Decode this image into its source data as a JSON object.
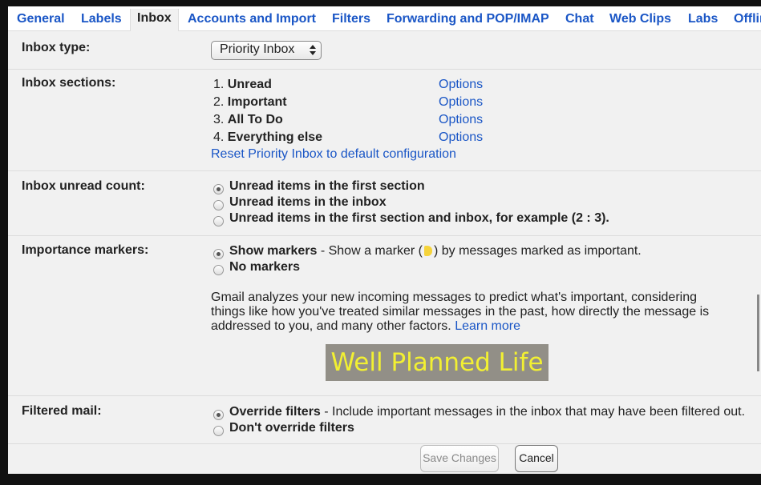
{
  "tabs": [
    "General",
    "Labels",
    "Inbox",
    "Accounts and Import",
    "Filters",
    "Forwarding and POP/IMAP",
    "Chat",
    "Web Clips",
    "Labs",
    "Offline"
  ],
  "inbox_type": {
    "label": "Inbox type:",
    "selected": "Priority Inbox"
  },
  "inbox_sections": {
    "label": "Inbox sections:",
    "items": [
      {
        "num": "1.",
        "name": "Unread",
        "options": "Options"
      },
      {
        "num": "2.",
        "name": "Important",
        "options": "Options"
      },
      {
        "num": "3.",
        "name": "All To Do",
        "options": "Options"
      },
      {
        "num": "4.",
        "name": "Everything else",
        "options": "Options"
      }
    ],
    "reset_link": "Reset Priority Inbox to default configuration"
  },
  "unread_count": {
    "label": "Inbox unread count:",
    "options": [
      "Unread items in the first section",
      "Unread items in the inbox",
      "Unread items in the first section and inbox, for example (2 : 3)."
    ],
    "selected_index": 0
  },
  "importance_markers": {
    "label": "Importance markers:",
    "show_title": "Show markers",
    "show_desc_before": " - Show a marker (",
    "show_desc_after": ") by messages marked as important.",
    "no_title": "No markers",
    "paragraph": "Gmail analyzes your new incoming messages to predict what's important, considering things like how you've treated similar messages in the past, how directly the message is addressed to you, and many other factors.",
    "learn_more": "Learn more",
    "marker_color": "#f5d33b"
  },
  "watermark": "Well Planned Life",
  "filtered_mail": {
    "label": "Filtered mail:",
    "override_title": "Override filters",
    "override_desc": " - Include important messages in the inbox that may have been filtered out.",
    "dont_override": "Don't override filters"
  },
  "buttons": {
    "save": "Save Changes",
    "cancel": "Cancel"
  },
  "colors": {
    "link": "#1a56c6",
    "watermark_bg": "#928f87",
    "watermark_text": "#f2f032"
  }
}
